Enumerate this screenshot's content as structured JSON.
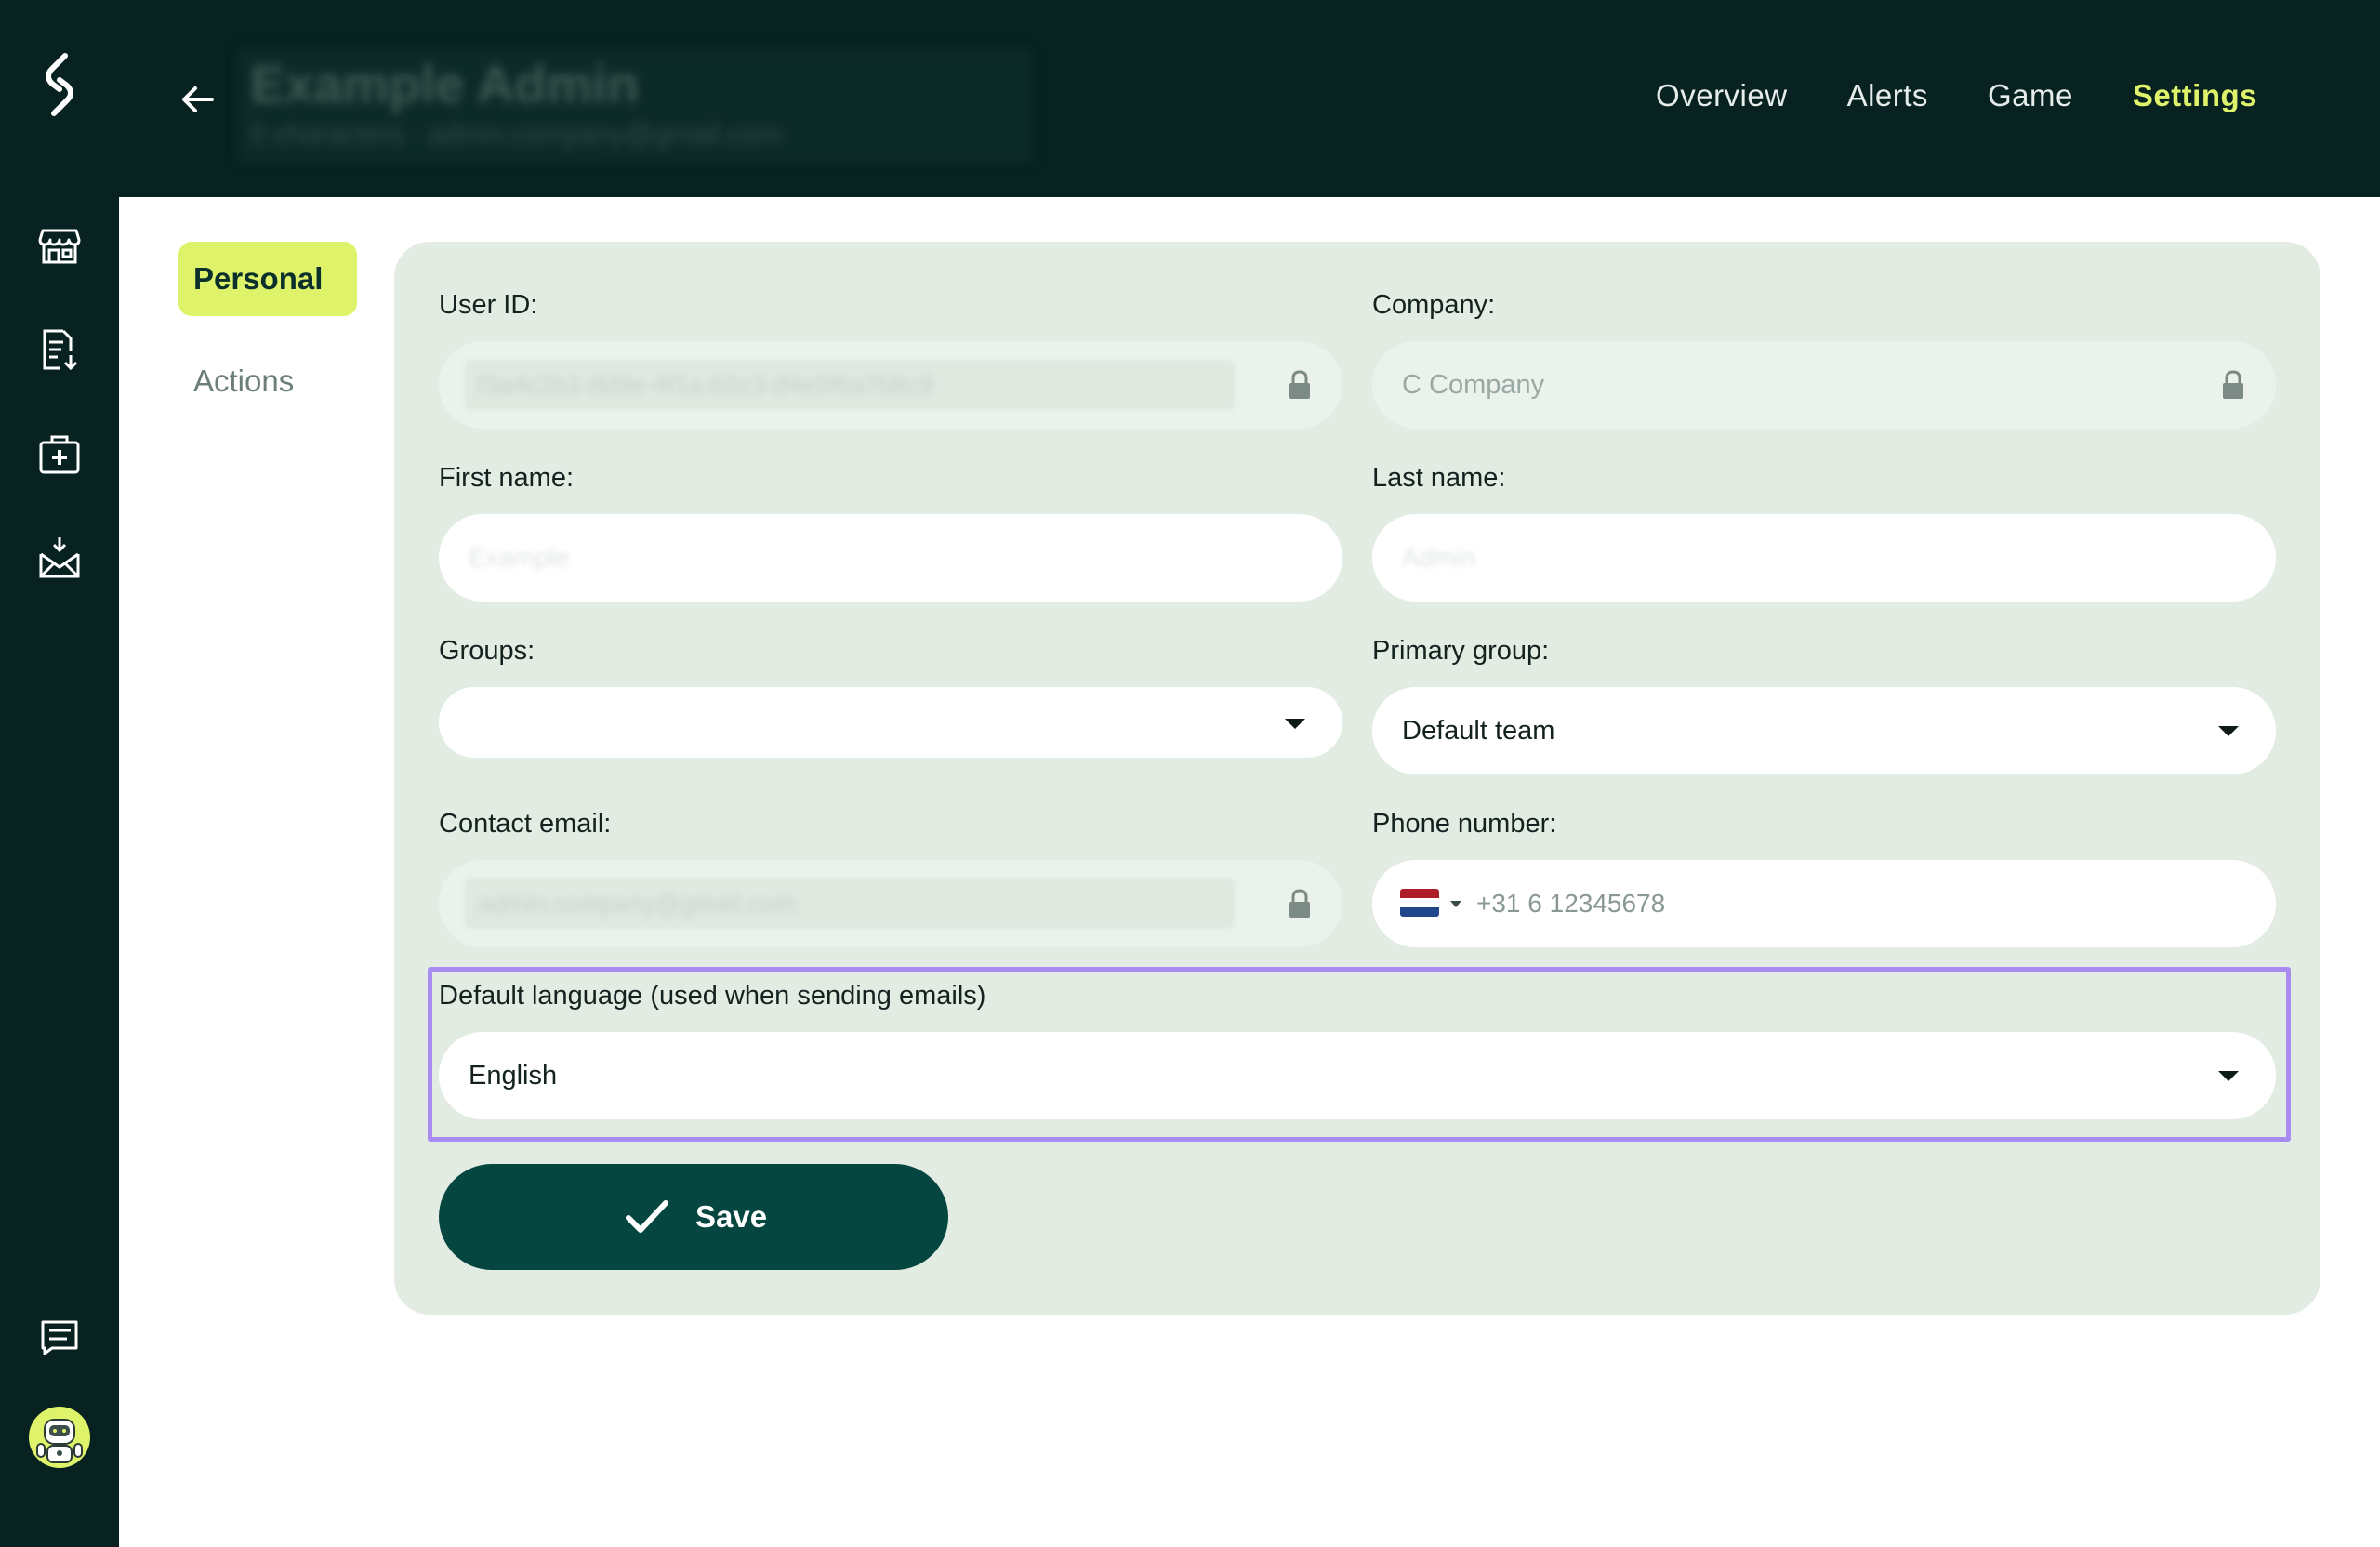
{
  "header": {
    "user_name": "Example Admin",
    "user_subtitle": "6 characters · admin.company@gmail.com",
    "nav": [
      {
        "label": "Overview"
      },
      {
        "label": "Alerts"
      },
      {
        "label": "Game"
      },
      {
        "label": "Settings",
        "active": true
      }
    ]
  },
  "sidebar": {
    "items": [
      {
        "icon": "store-icon"
      },
      {
        "icon": "document-download-icon"
      },
      {
        "icon": "first-aid-kit-icon"
      },
      {
        "icon": "mail-inbox-icon"
      },
      {
        "icon": "chat-message-icon"
      },
      {
        "icon": "robot-avatar-icon"
      }
    ]
  },
  "submenu": {
    "personal": "Personal",
    "actions": "Actions"
  },
  "form": {
    "user_id": {
      "label": "User ID:",
      "value": "f3a4c2b1-8d9e-4f1a-b2c3-d4e5f6a7b8c9"
    },
    "company": {
      "label": "Company:",
      "value": "C Company"
    },
    "first_name": {
      "label": "First name:",
      "value": "Example"
    },
    "last_name": {
      "label": "Last name:",
      "value": "Admin"
    },
    "groups": {
      "label": "Groups:",
      "value": ""
    },
    "primary_group": {
      "label": "Primary group:",
      "value": "Default team"
    },
    "contact_email": {
      "label": "Contact email:",
      "value": "admin.company@gmail.com"
    },
    "phone": {
      "label": "Phone number:",
      "placeholder": "+31 6 12345678",
      "country": "NL"
    },
    "language": {
      "label": "Default language (used when sending emails)",
      "value": "English"
    },
    "save_label": "Save"
  },
  "colors": {
    "dark_bg": "#072220",
    "accent": "#dff36a",
    "card_bg": "#e3ece3",
    "button": "#064640",
    "highlight": "#a98cf2"
  }
}
